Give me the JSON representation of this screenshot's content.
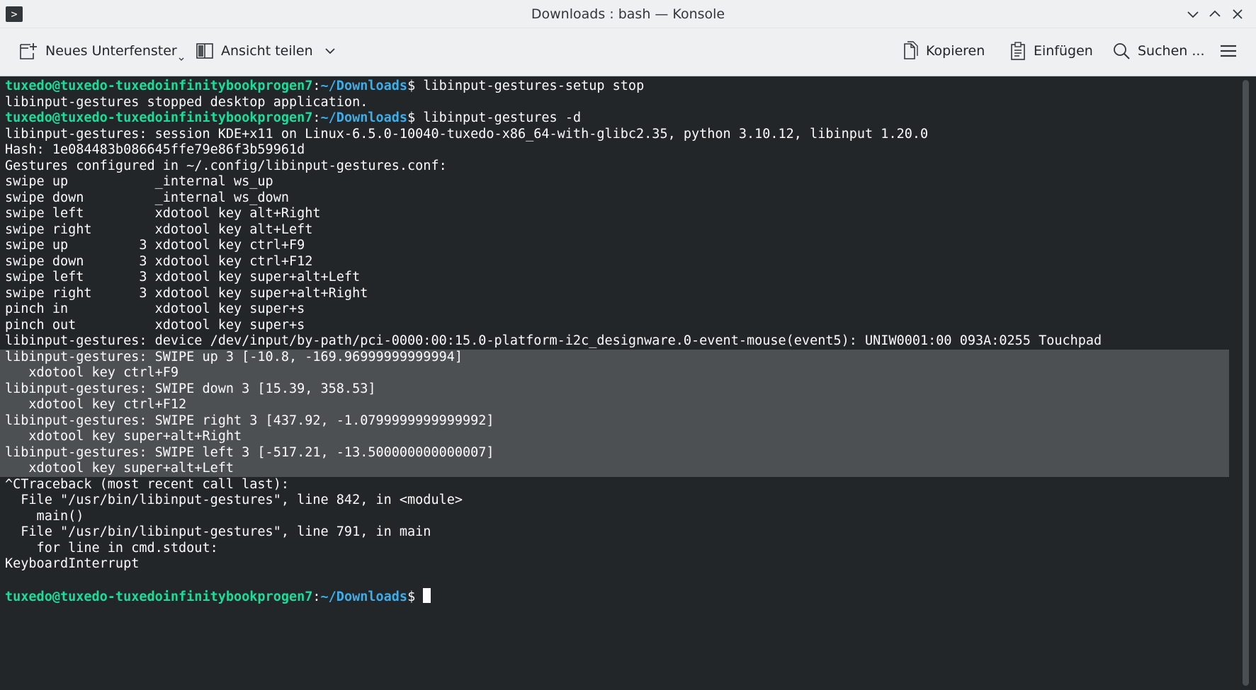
{
  "window": {
    "title": "Downloads : bash — Konsole",
    "app_icon_glyph": ">"
  },
  "toolbar": {
    "new_tab_label": "Neues Unterfenster",
    "split_view_label": "Ansicht teilen",
    "copy_label": "Kopieren",
    "paste_label": "Einfügen",
    "search_label": "Suchen ..."
  },
  "terminal": {
    "prompt_user": "tuxedo@tuxedo-tuxedoinfinitybookprogen7",
    "prompt_sep": ":",
    "prompt_path": "~/Downloads",
    "prompt_symbol": "$ ",
    "lines": [
      {
        "type": "prompt",
        "cmd": "libinput-gestures-setup stop"
      },
      {
        "type": "out",
        "text": "libinput-gestures stopped desktop application."
      },
      {
        "type": "prompt",
        "cmd": "libinput-gestures -d"
      },
      {
        "type": "out",
        "text": "libinput-gestures: session KDE+x11 on Linux-6.5.0-10040-tuxedo-x86_64-with-glibc2.35, python 3.10.12, libinput 1.20.0"
      },
      {
        "type": "out",
        "text": "Hash: 1e084483b086645ffe79e86f3b59961d"
      },
      {
        "type": "out",
        "text": "Gestures configured in ~/.config/libinput-gestures.conf:"
      },
      {
        "type": "out",
        "text": "swipe up           _internal ws_up"
      },
      {
        "type": "out",
        "text": "swipe down         _internal ws_down"
      },
      {
        "type": "out",
        "text": "swipe left         xdotool key alt+Right"
      },
      {
        "type": "out",
        "text": "swipe right        xdotool key alt+Left"
      },
      {
        "type": "out",
        "text": "swipe up         3 xdotool key ctrl+F9"
      },
      {
        "type": "out",
        "text": "swipe down       3 xdotool key ctrl+F12"
      },
      {
        "type": "out",
        "text": "swipe left       3 xdotool key super+alt+Left"
      },
      {
        "type": "out",
        "text": "swipe right      3 xdotool key super+alt+Right"
      },
      {
        "type": "out",
        "text": "pinch in           xdotool key super+s"
      },
      {
        "type": "out",
        "text": "pinch out          xdotool key super+s"
      },
      {
        "type": "out",
        "text": "libinput-gestures: device /dev/input/by-path/pci-0000:00:15.0-platform-i2c_designware.0-event-mouse(event5): UNIW0001:00 093A:0255 Touchpad"
      },
      {
        "type": "out",
        "selected": true,
        "text": "libinput-gestures: SWIPE up 3 [-10.8, -169.96999999999994]"
      },
      {
        "type": "out",
        "selected": true,
        "text": "   xdotool key ctrl+F9"
      },
      {
        "type": "out",
        "selected": true,
        "text": "libinput-gestures: SWIPE down 3 [15.39, 358.53]"
      },
      {
        "type": "out",
        "selected": true,
        "text": "   xdotool key ctrl+F12"
      },
      {
        "type": "out",
        "selected": true,
        "text": "libinput-gestures: SWIPE right 3 [437.92, -1.0799999999999992]"
      },
      {
        "type": "out",
        "selected": true,
        "text": "   xdotool key super+alt+Right"
      },
      {
        "type": "out",
        "selected": true,
        "text": "libinput-gestures: SWIPE left 3 [-517.21, -13.500000000000007]"
      },
      {
        "type": "out",
        "selected": true,
        "text": "   xdotool key super+alt+Left"
      },
      {
        "type": "out",
        "text": "^CTraceback (most recent call last):"
      },
      {
        "type": "out",
        "text": "  File \"/usr/bin/libinput-gestures\", line 842, in <module>"
      },
      {
        "type": "out",
        "text": "    main()"
      },
      {
        "type": "out",
        "text": "  File \"/usr/bin/libinput-gestures\", line 791, in main"
      },
      {
        "type": "out",
        "text": "    for line in cmd.stdout:"
      },
      {
        "type": "out",
        "text": "KeyboardInterrupt"
      },
      {
        "type": "out",
        "text": ""
      },
      {
        "type": "prompt",
        "cmd": "",
        "cursor": true
      }
    ]
  },
  "colors": {
    "background": "#232629",
    "foreground": "#fcfcfc",
    "prompt_user": "#1cdc9a",
    "prompt_path": "#3daee9",
    "selection": "#4d5053"
  },
  "icons": {
    "app": "konsole-icon",
    "new_tab": "new-tab-icon",
    "split_view": "split-view-icon",
    "copy": "copy-icon",
    "paste": "paste-icon",
    "search": "search-icon",
    "menu": "hamburger-menu-icon"
  }
}
